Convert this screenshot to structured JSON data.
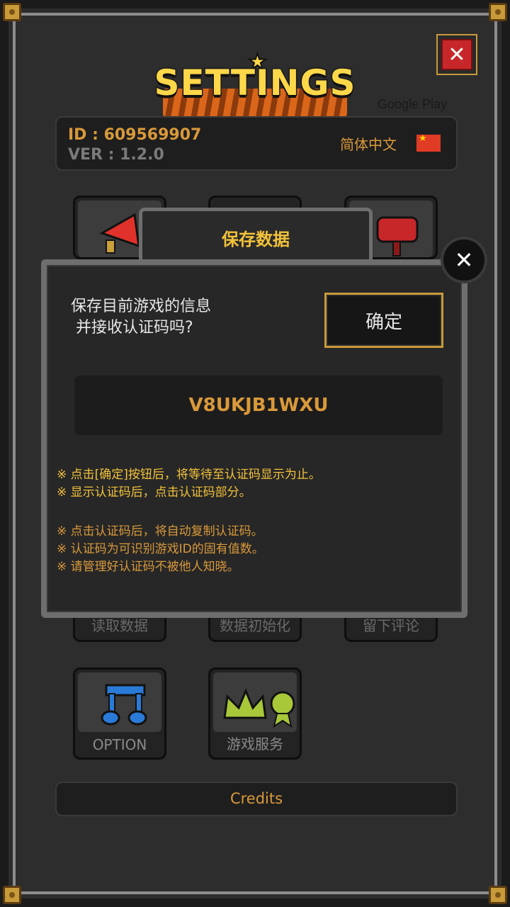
{
  "header": {
    "logo_text": "SETTINGS",
    "close_label": "✕",
    "store_label": "Google Play"
  },
  "info": {
    "id": "ID : 609569907",
    "version": "VER : 1.2.0",
    "language": "简体中文",
    "flag": "china-flag-icon"
  },
  "tiles": {
    "load_data": "读取数据",
    "reset_data": "数据初始化",
    "review": "留下评论",
    "option": "OPTION",
    "game_service": "游戏服务"
  },
  "credits_label": "Credits",
  "dialog": {
    "title": "保存数据",
    "close_label": "✕",
    "message": "保存目前游戏的信息\n 并接收认证码吗?",
    "confirm_label": "确定",
    "code": "V8UKJB1WXU",
    "notes_primary": [
      "※ 点击[确定]按钮后，将等待至认证码显示为止。",
      " ※ 显示认证码后，点击认证码部分。"
    ],
    "notes_secondary": [
      "※ 点击认证码后，将自动复制认证码。",
      " ※ 认证码为可识别游戏ID的固有值数。",
      " ※ 请管理好认证码不被他人知晓。"
    ]
  },
  "colors": {
    "accent_gold": "#d9993a",
    "title_yellow": "#f2c23a",
    "close_red": "#c8272a"
  }
}
